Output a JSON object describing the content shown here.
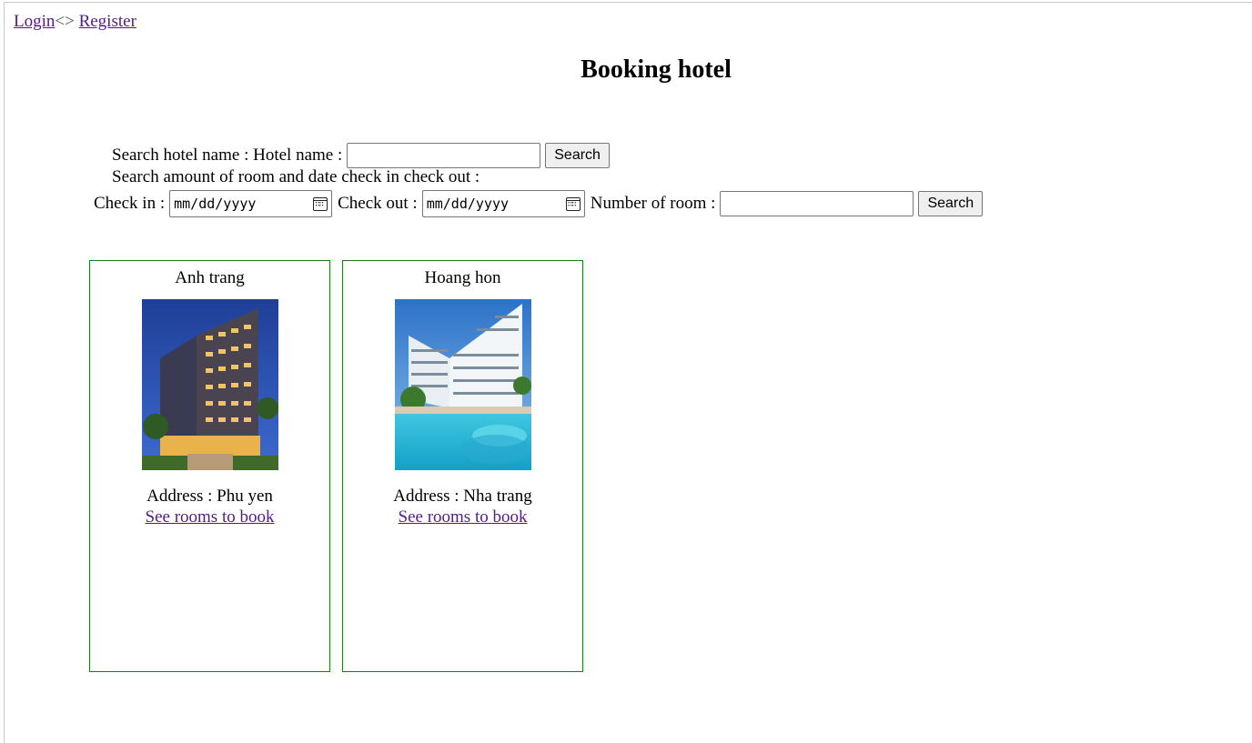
{
  "nav": {
    "login": "Login",
    "separator": "<>",
    "register": "Register"
  },
  "page_title": "Booking hotel",
  "search_name": {
    "label": "Search hotel name : Hotel name :",
    "value": "",
    "button": "Search"
  },
  "search_dates": {
    "heading": "Search amount of room and date check in check out :",
    "checkin_label": "Check in :",
    "checkin_placeholder": "mm/dd/yyyy",
    "checkout_label": "Check out :",
    "checkout_placeholder": "mm/dd/yyyy",
    "rooms_label": "Number of room :",
    "rooms_value": "",
    "button": "Search"
  },
  "hotels": [
    {
      "name": "Anh trang",
      "address": "Address : Phu yen",
      "link": "See rooms to book",
      "image": "hotel-building-night-photo"
    },
    {
      "name": "Hoang hon",
      "address": "Address : Nha trang",
      "link": "See rooms to book",
      "image": "hotel-pool-photo"
    }
  ],
  "colors": {
    "card_border": "#1a7a1a",
    "link": "#551a8b"
  }
}
